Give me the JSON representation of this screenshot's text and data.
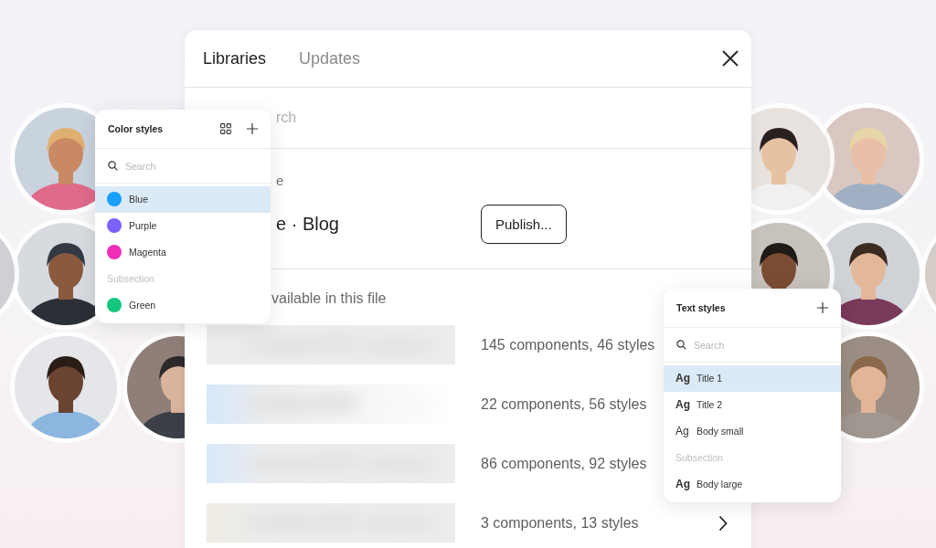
{
  "dialog": {
    "tabs": [
      {
        "label": "Libraries",
        "selected": true
      },
      {
        "label": "Updates",
        "selected": false
      }
    ],
    "search": {
      "placeholder": "rch"
    },
    "current_file": {
      "label": "e",
      "name": "e · Blog",
      "button": "Publish..."
    },
    "section_title": "vailable in this file",
    "libraries": [
      {
        "kind": "picture",
        "summary": "145 components, 46 styles"
      },
      {
        "kind": "picture",
        "summary": "22 components, 56 styles"
      },
      {
        "kind": "picture",
        "summary": "86 components, 92 styles"
      },
      {
        "kind": "picture",
        "summary": "3 components, 13 styles",
        "chevron": true
      }
    ]
  },
  "color_styles": {
    "title": "Color styles",
    "search": {
      "placeholder": "Search"
    },
    "items": [
      {
        "kind": "color",
        "label": "Blue",
        "color": "#18a0fb",
        "selected": true
      },
      {
        "kind": "color",
        "label": "Purple",
        "color": "#7b61ff",
        "selected": false
      },
      {
        "kind": "color",
        "label": "Magenta",
        "color": "#f02eb6",
        "selected": false
      },
      {
        "kind": "subsection",
        "label": "Subsection"
      },
      {
        "kind": "color",
        "label": "Green",
        "color": "#14c77c",
        "selected": false
      }
    ]
  },
  "text_styles": {
    "title": "Text styles",
    "search": {
      "placeholder": "Search"
    },
    "items": [
      {
        "kind": "style",
        "sample": "Ag",
        "label": "Title 1",
        "bold": true,
        "selected": true
      },
      {
        "kind": "style",
        "sample": "Ag",
        "label": "Title 2",
        "bold": true,
        "selected": false
      },
      {
        "kind": "style",
        "sample": "Ag",
        "label": "Body small",
        "bold": false,
        "selected": false
      },
      {
        "kind": "subsection",
        "label": "Subsection"
      },
      {
        "kind": "style",
        "sample": "Ag",
        "label": "Body large",
        "bold": true,
        "selected": false
      }
    ]
  }
}
